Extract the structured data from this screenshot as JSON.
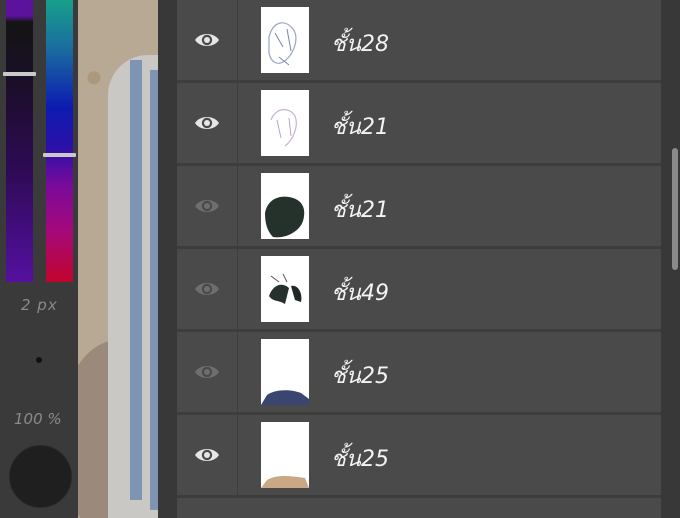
{
  "colors": {
    "panel_bg": "#4a4a4a",
    "eye_visible": "#e6e6e6",
    "eye_hidden": "#6e6e6e"
  },
  "tools": {
    "brush_size": "2 px",
    "opacity": "100 %"
  },
  "layers": [
    {
      "name": "ชั้น28",
      "visible": true,
      "eye_icon": "eye-icon"
    },
    {
      "name": "ชั้น21",
      "visible": true,
      "eye_icon": "eye-icon"
    },
    {
      "name": "ชั้น21",
      "visible": false,
      "eye_icon": "eye-icon"
    },
    {
      "name": "ชั้น49",
      "visible": false,
      "eye_icon": "eye-icon"
    },
    {
      "name": "ชั้น25",
      "visible": false,
      "eye_icon": "eye-icon"
    },
    {
      "name": "ชั้น25",
      "visible": true,
      "eye_icon": "eye-icon"
    }
  ]
}
